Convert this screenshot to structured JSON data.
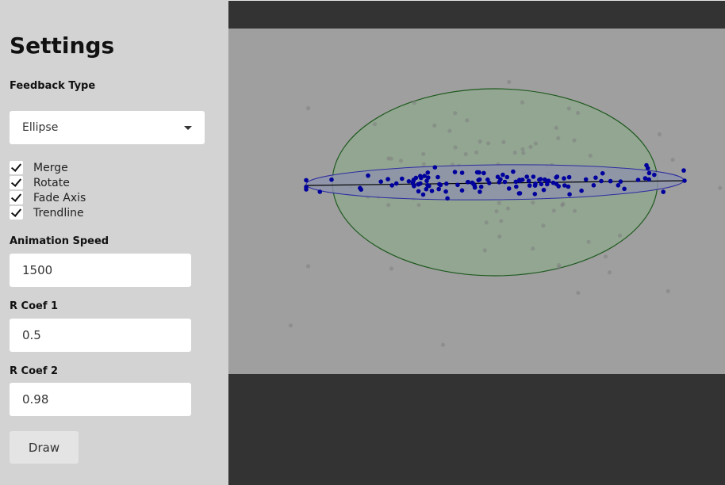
{
  "sidebar": {
    "title": "Settings",
    "feedback_type": {
      "label": "Feedback Type",
      "value": "Ellipse"
    },
    "checkboxes": [
      {
        "label": "Merge",
        "checked": true
      },
      {
        "label": "Rotate",
        "checked": true
      },
      {
        "label": "Fade Axis",
        "checked": true
      },
      {
        "label": "Trendline",
        "checked": true
      }
    ],
    "animation_speed": {
      "label": "Animation Speed",
      "value": "1500"
    },
    "r_coef_1": {
      "label": "R Coef 1",
      "value": "0.5"
    },
    "r_coef_2": {
      "label": "R Coef 2",
      "value": "0.98"
    },
    "draw_button": "Draw"
  },
  "colors": {
    "sidebar_bg": "#d3d3d3",
    "plot_bg": "#9f9f9f",
    "dark_bg": "#333333",
    "wide_ellipse_stroke": "#1f5a1f",
    "wide_ellipse_fill": "#8ea88e",
    "tight_ellipse_stroke": "#2c2ca0",
    "tight_ellipse_fill": "#8e93ad",
    "faded_points": "#7f7f7f",
    "strong_points": "#00009c",
    "trendline": "#000000"
  },
  "chart_data": {
    "type": "scatter",
    "faded_series_count": 90,
    "highlighted_series_count": 120
  }
}
